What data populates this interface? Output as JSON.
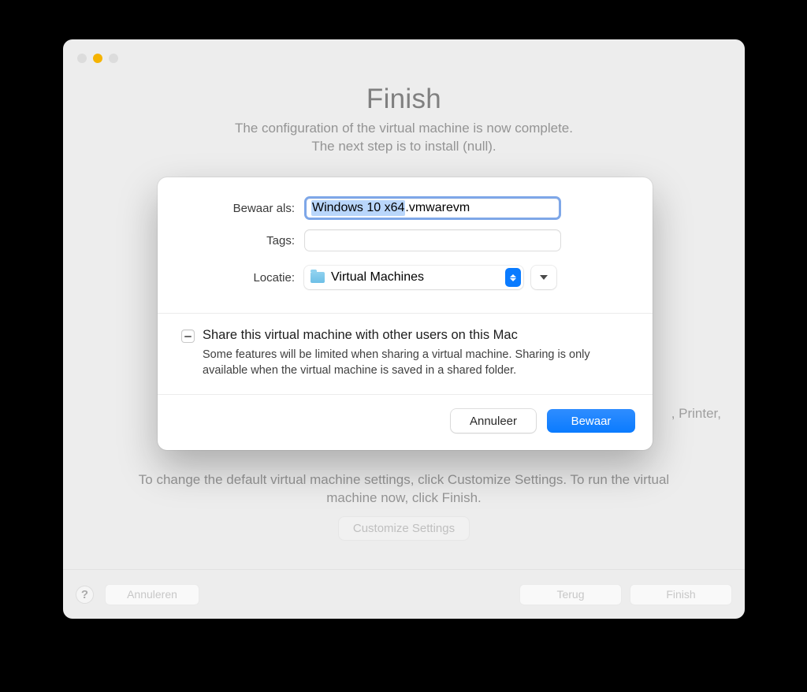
{
  "window": {
    "title": "Finish",
    "subtitle_line1": "The configuration of the virtual machine is now complete.",
    "subtitle_line2": "The next step is to install (null).",
    "bg_right_snippet": ", Printer,",
    "help_instructions": "To change the default virtual machine settings, click Customize Settings. To run the virtual machine now, click Finish.",
    "customize_label": "Customize Settings",
    "help_symbol": "?",
    "buttons": {
      "cancel": "Annuleren",
      "back": "Terug",
      "finish": "Finish"
    }
  },
  "sheet": {
    "labels": {
      "save_as": "Bewaar als:",
      "tags": "Tags:",
      "location": "Locatie:"
    },
    "filename_selected": "Windows 10 x64",
    "filename_extension": ".vmwarevm",
    "tags_value": "",
    "location_value": "Virtual Machines",
    "share": {
      "title": "Share this virtual machine with other users on this Mac",
      "description": "Some features will be limited when sharing a virtual machine. Sharing is only available when the virtual machine is saved in a shared folder.",
      "state": "mixed"
    },
    "actions": {
      "cancel": "Annuleer",
      "save": "Bewaar"
    }
  }
}
